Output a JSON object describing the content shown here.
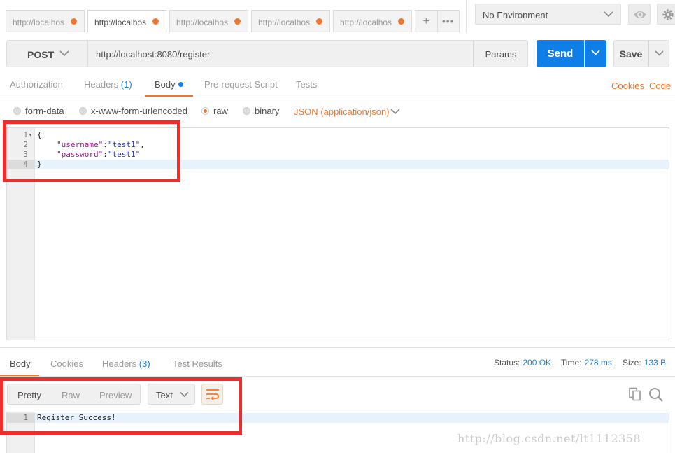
{
  "tabs": {
    "items": [
      {
        "label": "http://localhos"
      },
      {
        "label": "http://localhos"
      },
      {
        "label": "http://localhos"
      },
      {
        "label": "http://localhos"
      },
      {
        "label": "http://localhos"
      }
    ],
    "add_label": "+",
    "more_label": "•••"
  },
  "environment": {
    "selected": "No Environment"
  },
  "request": {
    "method": "POST",
    "url": "http://localhost:8080/register",
    "params_label": "Params",
    "send_label": "Send",
    "save_label": "Save"
  },
  "request_tabs": {
    "authorization": "Authorization",
    "headers": "Headers",
    "headers_count": "(1)",
    "body": "Body",
    "prerequest": "Pre-request Script",
    "tests": "Tests",
    "cookies": "Cookies",
    "code": "Code"
  },
  "body_types": {
    "form_data": "form-data",
    "urlencoded": "x-www-form-urlencoded",
    "raw": "raw",
    "binary": "binary",
    "content_type": "JSON (application/json)"
  },
  "request_body": {
    "lines": [
      {
        "num": "1",
        "text": "{"
      },
      {
        "num": "2",
        "key": "\"username\"",
        "sep": ":",
        "value": "\"test1\"",
        "end": ","
      },
      {
        "num": "3",
        "key": "\"password\"",
        "sep": ":",
        "value": "\"test1\"",
        "end": ""
      },
      {
        "num": "4",
        "text": "}"
      }
    ]
  },
  "response_tabs": {
    "body": "Body",
    "cookies": "Cookies",
    "headers": "Headers",
    "headers_count": "(3)",
    "test_results": "Test Results"
  },
  "response_meta": {
    "status_label": "Status:",
    "status_value": "200 OK",
    "time_label": "Time:",
    "time_value": "278 ms",
    "size_label": "Size:",
    "size_value": "133 B"
  },
  "response_view": {
    "pretty": "Pretty",
    "raw": "Raw",
    "preview": "Preview",
    "format": "Text"
  },
  "response_body": {
    "lines": [
      {
        "num": "1",
        "text": "Register Success!"
      }
    ]
  },
  "watermark": "http://blog.csdn.net/lt1112358",
  "colors": {
    "accent_orange": "#f0782e",
    "send_blue": "#0f7ee6",
    "link_blue": "#1f81d3",
    "annotation_red": "#ee2d2d"
  }
}
